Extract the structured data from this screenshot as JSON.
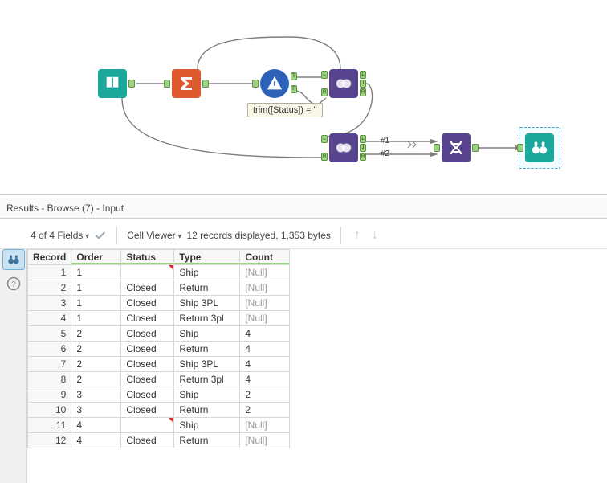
{
  "canvas": {
    "filter_tooltip": "trim([Status]) = ''",
    "union_lbl1": "#1",
    "union_lbl2": "#2",
    "anchor_t": "T",
    "anchor_f": "F",
    "anchor_l": "L",
    "anchor_j": "J",
    "anchor_r": "R"
  },
  "panel": {
    "title": "Results - Browse (7) - Input"
  },
  "toolbar": {
    "fields": "4 of 4 Fields",
    "cellviewer": "Cell Viewer",
    "records": "12 records displayed, 1,353 bytes"
  },
  "grid": {
    "headers": {
      "record": "Record",
      "order": "Order",
      "status": "Status",
      "type": "Type",
      "count": "Count"
    },
    "rows": [
      {
        "rec": "1",
        "order": "1",
        "status": "",
        "status_flag": true,
        "type": "Ship",
        "count": "[Null]",
        "cnull": true
      },
      {
        "rec": "2",
        "order": "1",
        "status": "Closed",
        "status_flag": false,
        "type": "Return",
        "count": "[Null]",
        "cnull": true
      },
      {
        "rec": "3",
        "order": "1",
        "status": "Closed",
        "status_flag": false,
        "type": "Ship 3PL",
        "count": "[Null]",
        "cnull": true
      },
      {
        "rec": "4",
        "order": "1",
        "status": "Closed",
        "status_flag": false,
        "type": "Return 3pl",
        "count": "[Null]",
        "cnull": true
      },
      {
        "rec": "5",
        "order": "2",
        "status": "Closed",
        "status_flag": false,
        "type": "Ship",
        "count": "4",
        "cnull": false
      },
      {
        "rec": "6",
        "order": "2",
        "status": "Closed",
        "status_flag": false,
        "type": "Return",
        "count": "4",
        "cnull": false
      },
      {
        "rec": "7",
        "order": "2",
        "status": "Closed",
        "status_flag": false,
        "type": "Ship 3PL",
        "count": "4",
        "cnull": false
      },
      {
        "rec": "8",
        "order": "2",
        "status": "Closed",
        "status_flag": false,
        "type": "Return 3pl",
        "count": "4",
        "cnull": false
      },
      {
        "rec": "9",
        "order": "3",
        "status": "Closed",
        "status_flag": false,
        "type": "Ship",
        "count": "2",
        "cnull": false
      },
      {
        "rec": "10",
        "order": "3",
        "status": "Closed",
        "status_flag": false,
        "type": "Return",
        "count": "2",
        "cnull": false
      },
      {
        "rec": "11",
        "order": "4",
        "status": "",
        "status_flag": true,
        "type": "Ship",
        "count": "[Null]",
        "cnull": true
      },
      {
        "rec": "12",
        "order": "4",
        "status": "Closed",
        "status_flag": false,
        "type": "Return",
        "count": "[Null]",
        "cnull": true
      }
    ]
  },
  "chart_data": {
    "type": "table",
    "columns": [
      "Record",
      "Order",
      "Status",
      "Type",
      "Count"
    ],
    "rows": [
      [
        1,
        1,
        "",
        "Ship",
        null
      ],
      [
        2,
        1,
        "Closed",
        "Return",
        null
      ],
      [
        3,
        1,
        "Closed",
        "Ship 3PL",
        null
      ],
      [
        4,
        1,
        "Closed",
        "Return 3pl",
        null
      ],
      [
        5,
        2,
        "Closed",
        "Ship",
        4
      ],
      [
        6,
        2,
        "Closed",
        "Return",
        4
      ],
      [
        7,
        2,
        "Closed",
        "Ship 3PL",
        4
      ],
      [
        8,
        2,
        "Closed",
        "Return 3pl",
        4
      ],
      [
        9,
        3,
        "Closed",
        "Ship",
        2
      ],
      [
        10,
        3,
        "Closed",
        "Return",
        2
      ],
      [
        11,
        4,
        "",
        "Ship",
        null
      ],
      [
        12,
        4,
        "Closed",
        "Return",
        null
      ]
    ]
  }
}
